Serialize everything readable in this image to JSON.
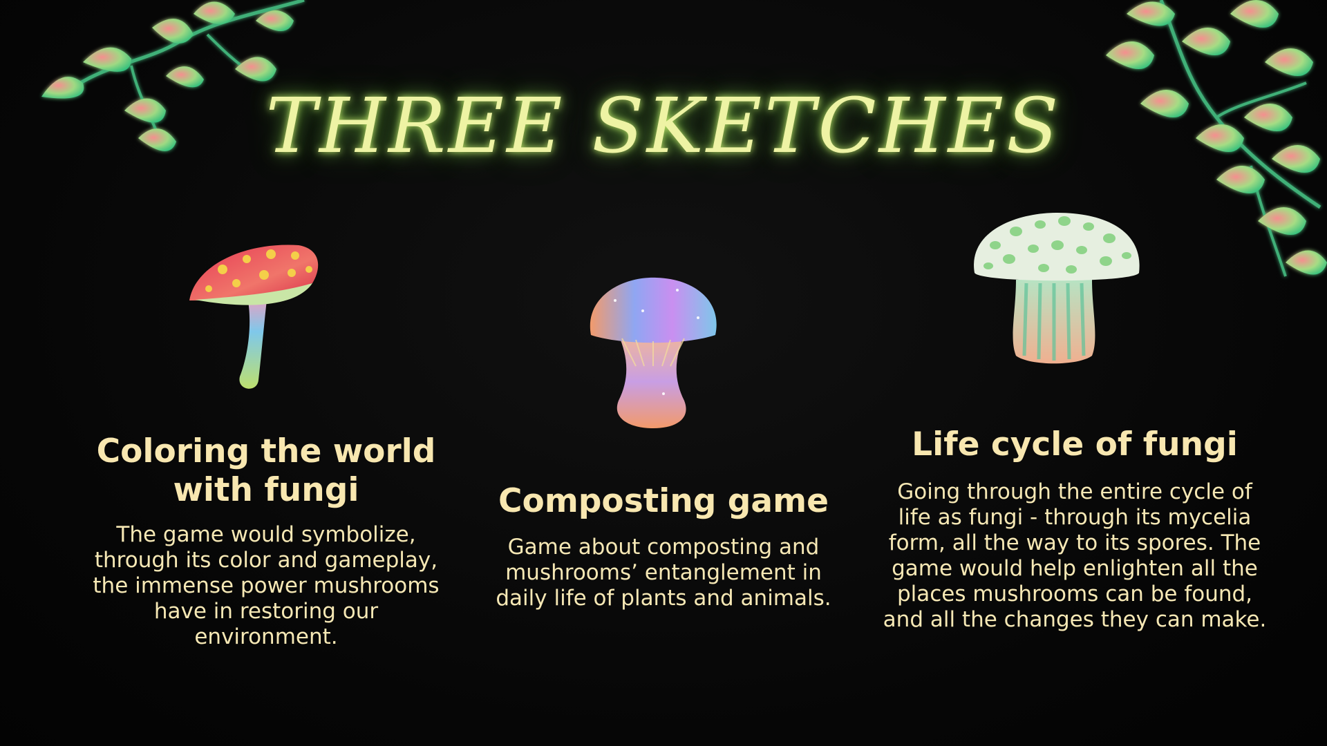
{
  "slide": {
    "title": "THREE SKETCHES",
    "sketches": [
      {
        "heading": "Coloring the world with fungi",
        "body": "The game would symbolize, through its color and gameplay, the immense power mushrooms have in restoring our environment.",
        "illustration": "red-spotted-mushroom-icon"
      },
      {
        "heading": "Composting game",
        "body": "Game about composting and mushrooms’ entanglement in daily life of plants and animals.",
        "illustration": "rainbow-mushroom-icon"
      },
      {
        "heading": "Life cycle of fungi",
        "body": "Going through the entire cycle of life as fungi - through its mycelia form, all the way to its spores. The game would help enlighten all the places mushrooms can be found, and all the changes they can make.",
        "illustration": "green-spotted-mushroom-icon"
      }
    ]
  },
  "decor": {
    "left_vine": "leafy-vine-icon",
    "right_vine": "leafy-vine-icon"
  },
  "colors": {
    "background": "#070707",
    "title": "#eef3a4",
    "text": "#f6e8b1",
    "leaf_green": "#4fd98a",
    "leaf_pink": "#f58f8f"
  }
}
